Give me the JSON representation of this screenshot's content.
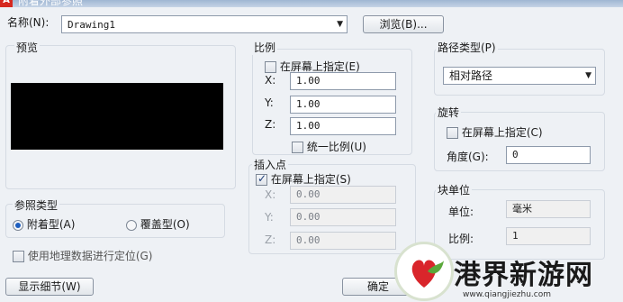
{
  "dialog": {
    "title": "附着外部参照",
    "title_icon": "autocad-logo"
  },
  "name_row": {
    "label": "名称(N):",
    "value": "Drawing1",
    "browse_button": "浏览(B)..."
  },
  "preview": {
    "label": "预览"
  },
  "scale": {
    "title": "比例",
    "specify_on_screen": "在屏幕上指定(E)",
    "specify_checked": false,
    "x_label": "X:",
    "x_value": "1.00",
    "y_label": "Y:",
    "y_value": "1.00",
    "z_label": "Z:",
    "z_value": "1.00",
    "uniform_label": "统一比例(U)",
    "uniform_checked": false
  },
  "path_type": {
    "title": "路径类型(P)",
    "selected": "相对路径"
  },
  "rotation": {
    "title": "旋转",
    "specify_on_screen": "在屏幕上指定(C)",
    "specify_checked": false,
    "angle_label": "角度(G):",
    "angle_value": "0"
  },
  "insertion_point": {
    "title": "插入点",
    "specify_on_screen": "在屏幕上指定(S)",
    "specify_checked": true,
    "x_label": "X:",
    "x_value": "0.00",
    "y_label": "Y:",
    "y_value": "0.00",
    "z_label": "Z:",
    "z_value": "0.00"
  },
  "reference_type": {
    "title": "参照类型",
    "attach_label": "附着型(A)",
    "attach_selected": true,
    "overlay_label": "覆盖型(O)",
    "overlay_selected": false
  },
  "geo_location": {
    "label": "使用地理数据进行定位(G)",
    "checked": false
  },
  "block_unit": {
    "title": "块单位",
    "unit_label": "单位:",
    "unit_value": "毫米",
    "factor_label": "比例:",
    "factor_value": "1"
  },
  "footer": {
    "details_button": "显示细节(W)",
    "ok_button": "确定"
  },
  "watermark": {
    "text": "港界新游网",
    "url": "www.qiangjiezhu.com"
  }
}
